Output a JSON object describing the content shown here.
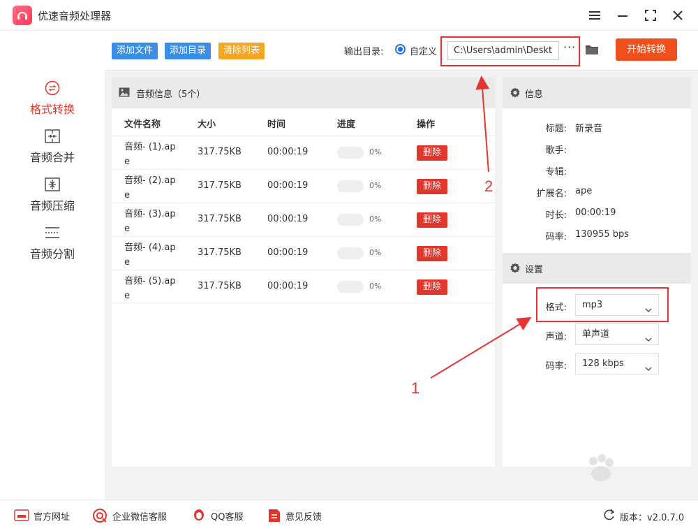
{
  "app": {
    "title": "优速音频处理器"
  },
  "sidebar": {
    "items": [
      {
        "label": "格式转换",
        "icon": "convert-icon",
        "active": true
      },
      {
        "label": "音频合并",
        "icon": "merge-icon",
        "active": false
      },
      {
        "label": "音频压缩",
        "icon": "compress-icon",
        "active": false
      },
      {
        "label": "音频分割",
        "icon": "split-icon",
        "active": false
      }
    ]
  },
  "toolbar": {
    "add_file": "添加文件",
    "add_dir": "添加目录",
    "clear_list": "清除列表",
    "output_label": "输出目录:",
    "custom_label": "自定义",
    "output_path": "C:\\Users\\admin\\Deskto",
    "more": "···",
    "start": "开始转换"
  },
  "file_panel": {
    "title": "音频信息（5个）",
    "columns": [
      "文件名称",
      "大小",
      "时间",
      "进度",
      "操作"
    ],
    "rows": [
      {
        "name": "音频- (1).ape",
        "size": "317.75KB",
        "time": "00:00:19",
        "progress": "0%",
        "action": "删除"
      },
      {
        "name": "音频- (2).ape",
        "size": "317.75KB",
        "time": "00:00:19",
        "progress": "0%",
        "action": "删除"
      },
      {
        "name": "音频- (3).ape",
        "size": "317.75KB",
        "time": "00:00:19",
        "progress": "0%",
        "action": "删除"
      },
      {
        "name": "音频- (4).ape",
        "size": "317.75KB",
        "time": "00:00:19",
        "progress": "0%",
        "action": "删除"
      },
      {
        "name": "音频- (5).ape",
        "size": "317.75KB",
        "time": "00:00:19",
        "progress": "0%",
        "action": "删除"
      }
    ]
  },
  "info_panel": {
    "title": "信息",
    "fields": [
      {
        "label": "标题:",
        "value": "新录音"
      },
      {
        "label": "歌手:",
        "value": ""
      },
      {
        "label": "专辑:",
        "value": ""
      },
      {
        "label": "扩展名:",
        "value": "ape"
      },
      {
        "label": "时长:",
        "value": "00:00:19"
      },
      {
        "label": "码率:",
        "value": "130955 bps"
      }
    ]
  },
  "settings": {
    "title": "设置",
    "format_label": "格式:",
    "format_value": "mp3",
    "channel_label": "声道:",
    "channel_value": "单声道",
    "bitrate_label": "码率:",
    "bitrate_value": "128 kbps"
  },
  "annotations": {
    "one": "1",
    "two": "2"
  },
  "footer": {
    "website": "官方网址",
    "wechat": "企业微信客服",
    "qq": "QQ客服",
    "feedback": "意见反馈",
    "version": "版本：v2.0.7.0"
  },
  "colors": {
    "accent_red": "#e0362b",
    "start_orange": "#f0501e",
    "blue_btn": "#3a8ee6",
    "orange_btn": "#f5a623"
  }
}
